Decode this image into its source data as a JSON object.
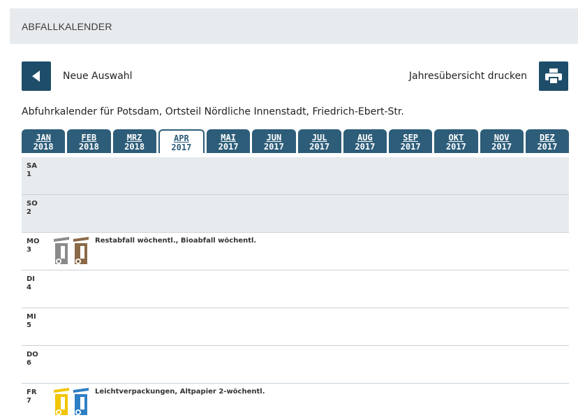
{
  "header": {
    "title": "ABFALLKALENDER"
  },
  "toolbar": {
    "back_label": "Neue Auswahl",
    "print_label": "Jahresübersicht drucken"
  },
  "subtitle": "Abfuhrkalender für Potsdam, Ortsteil Nördliche Innenstadt, Friedrich-Ebert-Str.",
  "tabs": [
    {
      "month": "JAN",
      "year": "2018"
    },
    {
      "month": "FEB",
      "year": "2018"
    },
    {
      "month": "MRZ",
      "year": "2018"
    },
    {
      "month": "APR",
      "year": "2017",
      "active": true
    },
    {
      "month": "MAI",
      "year": "2017"
    },
    {
      "month": "JUN",
      "year": "2017"
    },
    {
      "month": "JUL",
      "year": "2017"
    },
    {
      "month": "AUG",
      "year": "2017"
    },
    {
      "month": "SEP",
      "year": "2017"
    },
    {
      "month": "OKT",
      "year": "2017"
    },
    {
      "month": "NOV",
      "year": "2017"
    },
    {
      "month": "DEZ",
      "year": "2017"
    }
  ],
  "days": [
    {
      "weekday": "SA",
      "day": "1",
      "weekend": true
    },
    {
      "weekday": "SO",
      "day": "2",
      "weekend": true
    },
    {
      "weekday": "MO",
      "day": "3",
      "text": "Restabfall wöchentl., Bioabfall wöchentl.",
      "bins": [
        "restabfall-bin-icon",
        "bioabfall-bin-icon"
      ]
    },
    {
      "weekday": "DI",
      "day": "4"
    },
    {
      "weekday": "MI",
      "day": "5"
    },
    {
      "weekday": "DO",
      "day": "6"
    },
    {
      "weekday": "FR",
      "day": "7",
      "text": "Leichtverpackungen, Altpapier 2-wöchentl.",
      "bins": [
        "leichtverpackungen-bin-icon",
        "altpapier-bin-icon"
      ]
    }
  ],
  "colors": {
    "primary": "#1e4d69",
    "tab": "#2d5d79",
    "header_bg": "#e8ebee",
    "restabfall": "#8a8a8a",
    "bioabfall": "#8b6a47",
    "leichtverpackungen": "#f2c500",
    "altpapier": "#2f7fc4"
  }
}
